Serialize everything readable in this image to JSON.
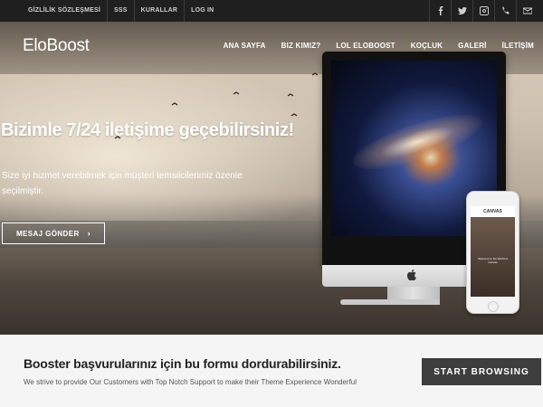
{
  "topbar": {
    "links": [
      "GİZLİLİK SÖZLEŞMESİ",
      "SSS",
      "KURALLAR",
      "LOG IN"
    ],
    "social_icons": [
      "facebook-icon",
      "twitter-icon",
      "instagram-icon",
      "phone-icon",
      "mail-icon"
    ]
  },
  "header": {
    "logo": "EloBoost",
    "nav": [
      "ANA SAYFA",
      "BIZ KIMIZ?",
      "LOL ELOBOOST",
      "KOÇLUK",
      "GALERİ",
      "İLETİŞİM"
    ]
  },
  "hero": {
    "headline": "Bizimle 7/24 iletişime geçebilirsiniz!",
    "subtext": "Size iyi hizmet verebilmek için müşteri temsilcilerimiz özenle seçilmiştir.",
    "cta_label": "MESAJ GÖNDER",
    "cta_icon": "chevron-right-icon"
  },
  "device_mockup": {
    "phone_header": "CANVAS",
    "phone_caption": "Welcome to the World of Canvas"
  },
  "band": {
    "title": "Booster başvurularınız için bu formu dordurabilirsiniz.",
    "text": "We strive to provide Our Customers with Top Notch Support to make their Theme Experience Wonderful",
    "button_label": "START BROWSING"
  },
  "colors": {
    "topbar_bg": "#1f1f1f",
    "band_bg": "#f5f5f5",
    "button_bg": "#3e3e3e"
  }
}
